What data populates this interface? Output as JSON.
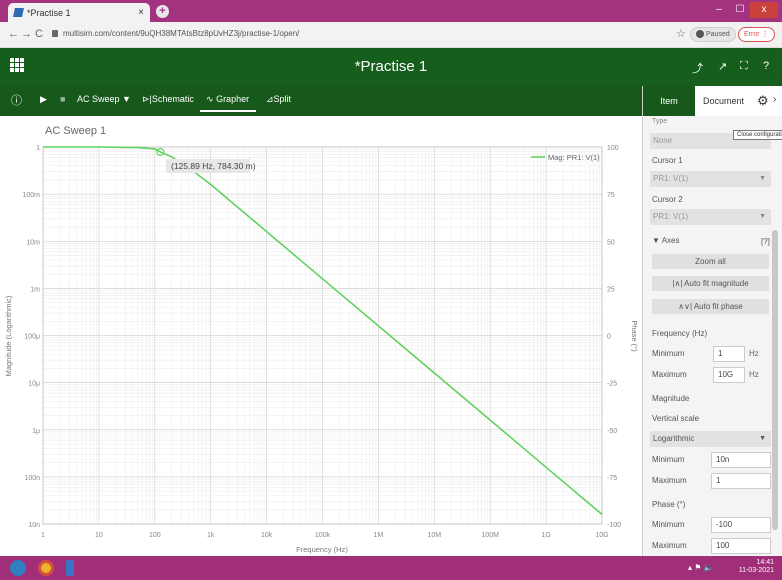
{
  "browser": {
    "tab_title": "*Practise 1",
    "tab_close": "×",
    "new_tab": "+",
    "url": "multisim.com/content/9uQH38MTAtsBtz8pUvHZ3j/practise-1/open/",
    "paused_label": "Paused",
    "error_label": "Error",
    "win_min": "–",
    "win_max": "☐",
    "win_close": "x"
  },
  "app": {
    "title": "*Practise 1"
  },
  "toolbar": {
    "info": "ⓘ",
    "play": "▶",
    "stop": "■",
    "analysis": "AC Sweep ▼",
    "schematic": "Schematic",
    "grapher": "Grapher",
    "split": "Split"
  },
  "graph": {
    "title": "AC Sweep 1",
    "ylabel_left": "Magnitude (Logarithmic)",
    "ylabel_right": "Phase (°)",
    "xlabel": "Frequency (Hz)",
    "cursor_label": "(125.89 Hz, 784.30 m)",
    "legend": "Mag: PR1: V(1)"
  },
  "chart_data": {
    "type": "line",
    "title": "AC Sweep 1",
    "xlabel": "Frequency (Hz)",
    "ylabel": "Magnitude (Logarithmic)",
    "ylabel_right": "Phase (°)",
    "x_scale": "log",
    "y_scale": "log",
    "xlim": [
      1,
      10000000000
    ],
    "ylim": [
      1e-08,
      1
    ],
    "y2lim": [
      -100,
      100
    ],
    "grid": true,
    "legend_position": "top-right",
    "x_ticks": [
      "1",
      "10",
      "100",
      "1k",
      "10k",
      "100k",
      "1M",
      "10M",
      "100M",
      "1G",
      "10G"
    ],
    "y_ticks": [
      "1",
      "100m",
      "10m",
      "1m",
      "100μ",
      "10μ",
      "1μ",
      "100n",
      "10n"
    ],
    "y2_ticks": [
      "100",
      "75",
      "50",
      "25",
      "0",
      "-25",
      "-50",
      "-75",
      "-100"
    ],
    "series": [
      {
        "name": "Mag: PR1: V(1)",
        "color": "#5fd35f",
        "x": [
          1,
          10,
          50,
          100,
          125.89,
          200,
          500,
          1000,
          10000,
          100000,
          1000000,
          10000000,
          100000000,
          1000000000,
          10000000000
        ],
        "y": [
          1,
          0.999,
          0.97,
          0.91,
          0.7843,
          0.62,
          0.3,
          0.16,
          0.016,
          0.0016,
          0.00016,
          1.6e-05,
          1.6e-06,
          1.6e-07,
          1.6e-08
        ]
      }
    ],
    "cursor": {
      "x": 125.89,
      "y": 0.7843,
      "label": "(125.89 Hz, 784.30 m)"
    }
  },
  "panel": {
    "tab_item": "Item",
    "tab_document": "Document",
    "tooltip": "Close configuration pane",
    "type_label": "Type",
    "type_value": "None",
    "cursor1_label": "Cursor 1",
    "cursor1_value": "PR1: V(1)",
    "cursor2_label": "Cursor 2",
    "cursor2_value": "PR1: V(1)",
    "axes_label": "Axes",
    "help": "[?]",
    "zoom_all": "Zoom all",
    "auto_mag": "Auto fit magnitude",
    "auto_phase": "Auto fit phase",
    "freq_label": "Frequency (Hz)",
    "freq_min_label": "Minimum",
    "freq_min": "1",
    "freq_max_label": "Maximum",
    "freq_max": "10G",
    "hz": "Hz",
    "mag_label": "Magnitude",
    "vscale_label": "Vertical scale",
    "vscale_value": "Logarithmic",
    "mag_min_label": "Minimum",
    "mag_min": "10n",
    "mag_max_label": "Maximum",
    "mag_max": "1",
    "phase_label": "Phase (°)",
    "phase_min_label": "Minimum",
    "phase_min": "-100",
    "phase_max_label": "Maximum",
    "phase_max": "100"
  },
  "taskbar": {
    "time": "14:41",
    "date": "11-03-2021"
  }
}
